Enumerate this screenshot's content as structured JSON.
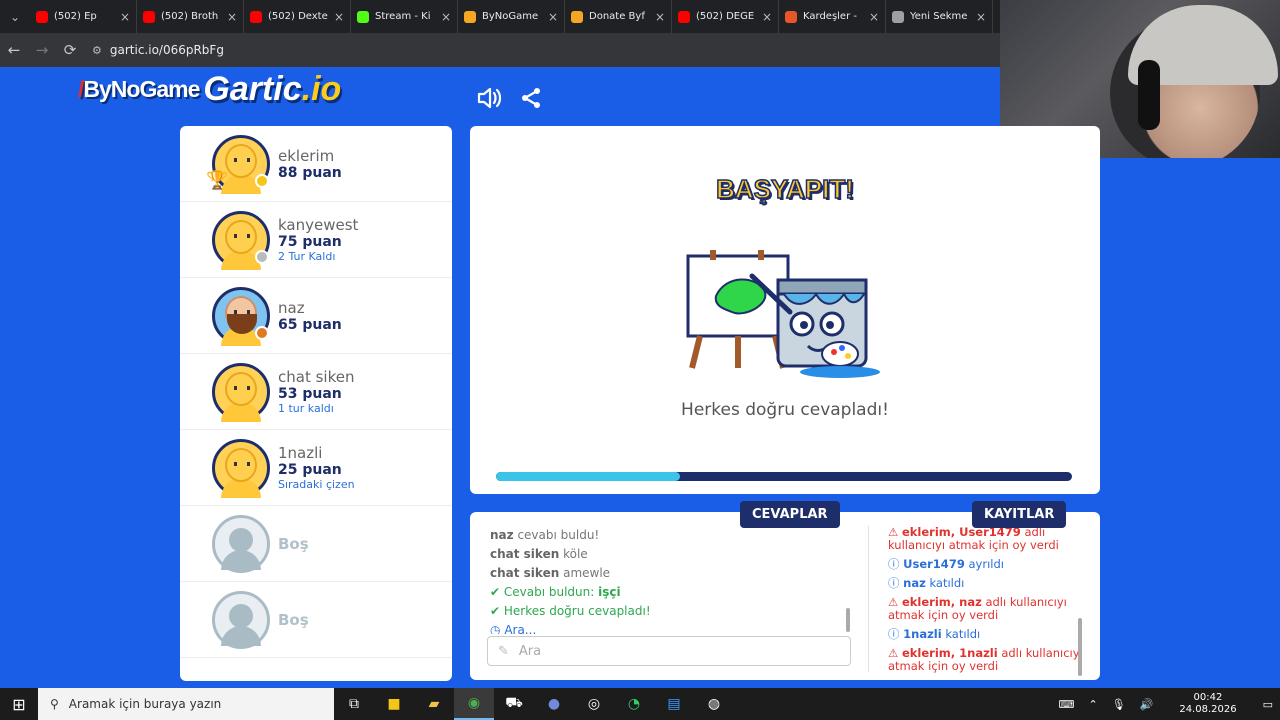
{
  "browser": {
    "tabs": [
      {
        "title": "(502) Ep",
        "color": "#ff0000"
      },
      {
        "title": "(502) Broth",
        "color": "#ff0000"
      },
      {
        "title": "(502) Dexte",
        "color": "#ff0000"
      },
      {
        "title": "Stream - Ki",
        "color": "#53fc18"
      },
      {
        "title": "ByNoGame",
        "color": "#f5a623"
      },
      {
        "title": "Donate Byf",
        "color": "#f5a623"
      },
      {
        "title": "(502) DEĞE",
        "color": "#ff0000"
      },
      {
        "title": "Kardeşler - ",
        "color": "#e8552a"
      },
      {
        "title": "Yeni Sekme",
        "color": "#9aa0a6"
      }
    ],
    "url": "gartic.io/066pRbFg"
  },
  "logo": {
    "bynogame": "ByNoGame",
    "gartic": "Gartic",
    "io": ".io"
  },
  "players": [
    {
      "name": "eklerim",
      "points": "88 puan",
      "extra": "",
      "trophy": "2",
      "status_color": "#f5c518",
      "avatar": "default"
    },
    {
      "name": "kanyewest",
      "points": "75 puan",
      "extra": "2 Tur Kaldı",
      "trophy": "",
      "status_color": "#bbbbbb",
      "avatar": "default"
    },
    {
      "name": "naz",
      "points": "65 puan",
      "extra": "",
      "trophy": "",
      "status_color": "#e07b1f",
      "avatar": "naz"
    },
    {
      "name": "chat siken",
      "points": "53 puan",
      "extra": "1 tur kaldı",
      "trophy": "",
      "status_color": "",
      "avatar": "default"
    },
    {
      "name": "1nazli",
      "points": "25 puan",
      "extra": "Sıradaki çizen",
      "trophy": "",
      "status_color": "",
      "avatar": "default"
    }
  ],
  "empty_slots": [
    "Boş",
    "Boş"
  ],
  "canvas": {
    "headline": "BAŞYAPIT!",
    "message": "Herkes doğru cevapladı!",
    "progress_percent": 32
  },
  "tabs": {
    "answers": "CEVAPLAR",
    "logs": "KAYITLAR"
  },
  "answers": [
    {
      "type": "chat",
      "user": "naz",
      "text": "cevabı buldu!"
    },
    {
      "type": "chat",
      "user": "chat siken",
      "text": "köle"
    },
    {
      "type": "chat",
      "user": "chat siken",
      "text": "amewle"
    },
    {
      "type": "ok",
      "text": "Cevabı buldun:",
      "bold": "işçi"
    },
    {
      "type": "ok",
      "text": "Herkes doğru cevapladı!",
      "bold": ""
    },
    {
      "type": "info",
      "text": "Ara...",
      "bold": ""
    }
  ],
  "guess_placeholder": "Ara",
  "logs": [
    {
      "type": "warn",
      "bold": "eklerim, User1479",
      "text": "adlı kullanıcıyı atmak için oy verdi"
    },
    {
      "type": "info",
      "bold": "User1479",
      "text": "ayrıldı"
    },
    {
      "type": "info",
      "bold": "naz",
      "text": "katıldı"
    },
    {
      "type": "warn",
      "bold": "eklerim, naz",
      "text": "adlı kullanıcıyı atmak için oy verdi"
    },
    {
      "type": "info",
      "bold": "1nazli",
      "text": "katıldı"
    },
    {
      "type": "warn",
      "bold": "eklerim, 1nazli",
      "text": "adlı kullanıcıyı atmak için oy verdi"
    }
  ],
  "taskbar": {
    "search_placeholder": "Aramak için buraya yazın",
    "time": "00:42",
    "date": "24.08.2026"
  }
}
